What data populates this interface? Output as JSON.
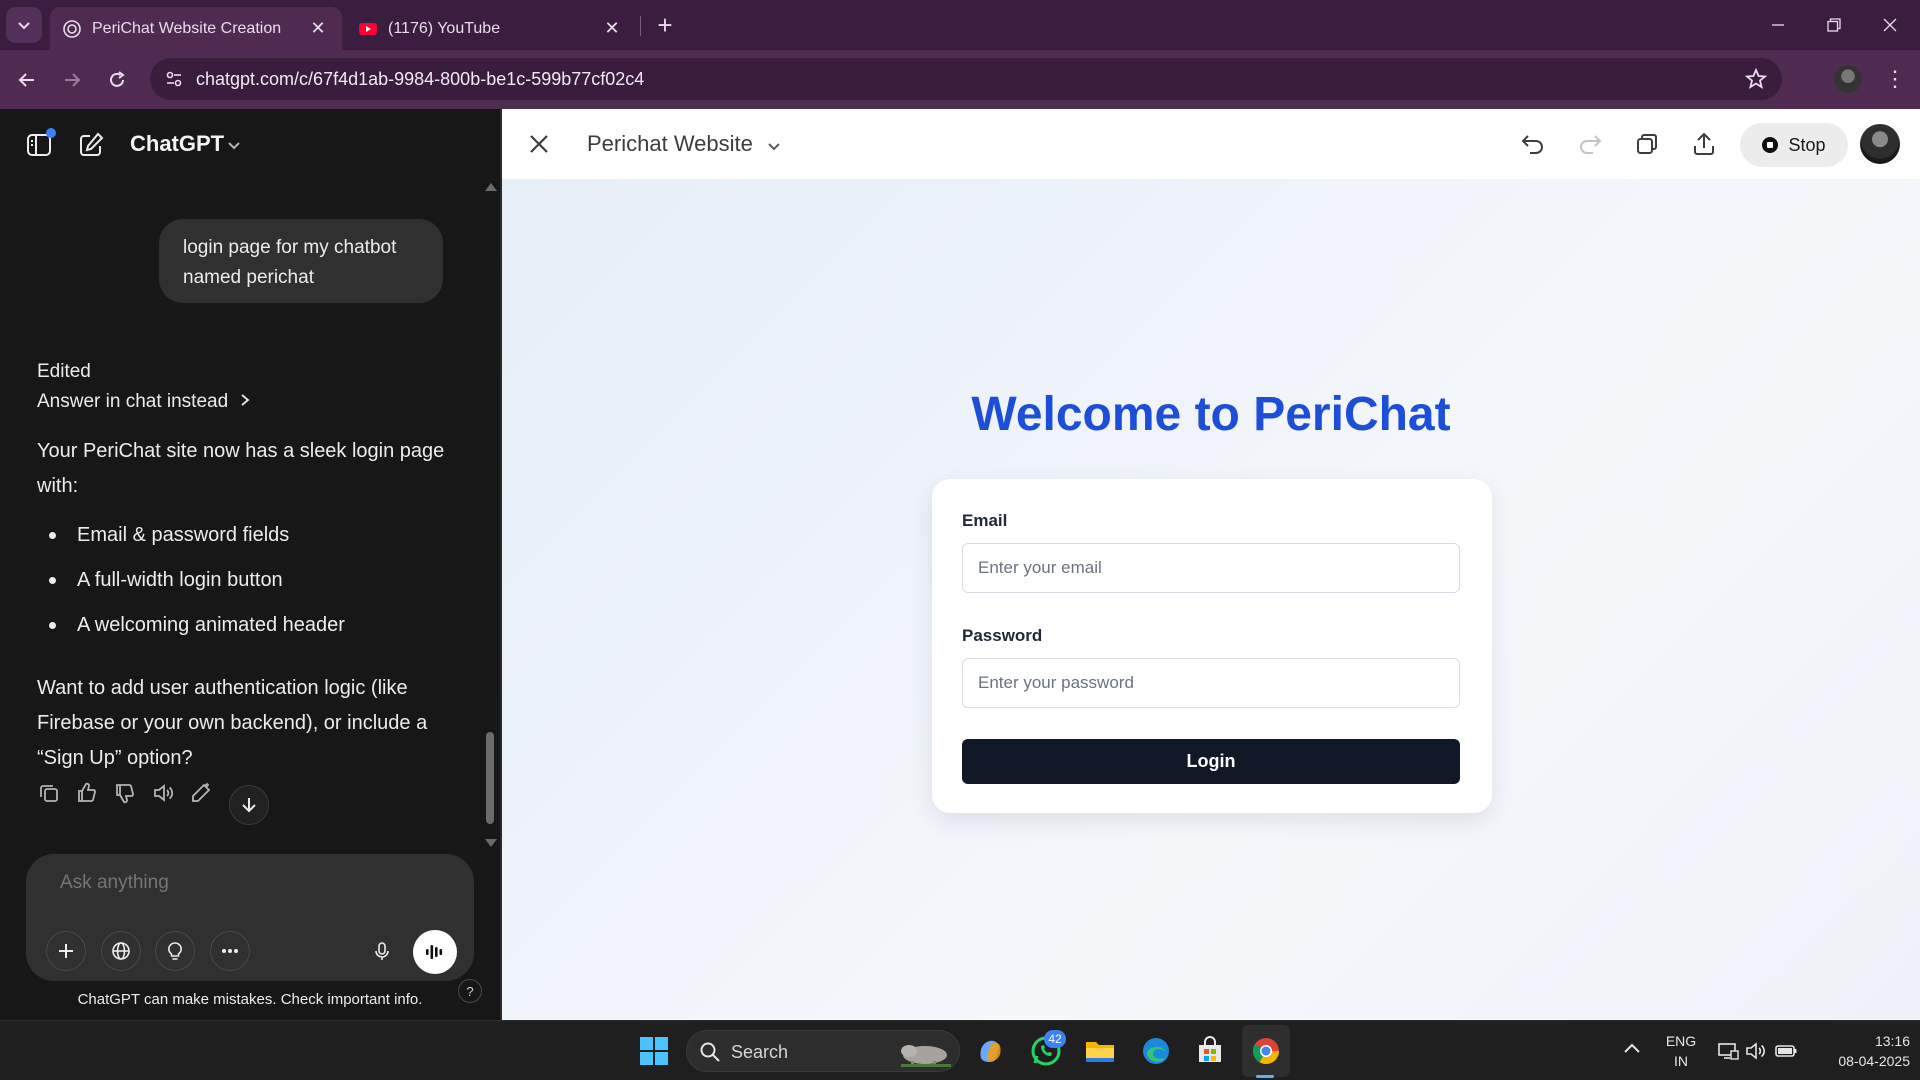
{
  "browser": {
    "tabs": [
      {
        "title": "PeriChat Website Creation",
        "active": true
      },
      {
        "title": "(1176) YouTube",
        "active": false
      }
    ],
    "url": "chatgpt.com/c/67f4d1ab-9984-800b-be1c-599b77cf02c4"
  },
  "chat": {
    "model": "ChatGPT",
    "user_message": "login page for my chatbot named perichat",
    "edited_label": "Edited",
    "answer_in_chat": "Answer in chat instead",
    "intro": "Your PeriChat site now has a sleek login page with:",
    "bullets": [
      "Email & password fields",
      "A full-width login button",
      "A welcoming animated header"
    ],
    "followup": "Want to add user authentication logic (like Firebase or your own backend), or include a “Sign Up” option?",
    "composer_placeholder": "Ask anything",
    "disclaimer": "ChatGPT can make mistakes. Check important info.",
    "help": "?"
  },
  "canvas": {
    "title": "Perichat Website",
    "stop_label": "Stop",
    "preview": {
      "heading": "Welcome to PeriChat",
      "email_label": "Email",
      "email_placeholder": "Enter your email",
      "password_label": "Password",
      "password_placeholder": "Enter your password",
      "login_label": "Login"
    }
  },
  "taskbar": {
    "search_label": "Search",
    "whatsapp_badge": "42",
    "lang_line1": "ENG",
    "lang_line2": "IN",
    "time": "13:16",
    "date": "08-04-2025"
  },
  "colors": {
    "tab_strip": "#3b1e3f",
    "toolbar": "#4f2b52",
    "chat_bg": "#171717",
    "heading_blue": "#1d4ed8",
    "login_button": "#111827"
  }
}
